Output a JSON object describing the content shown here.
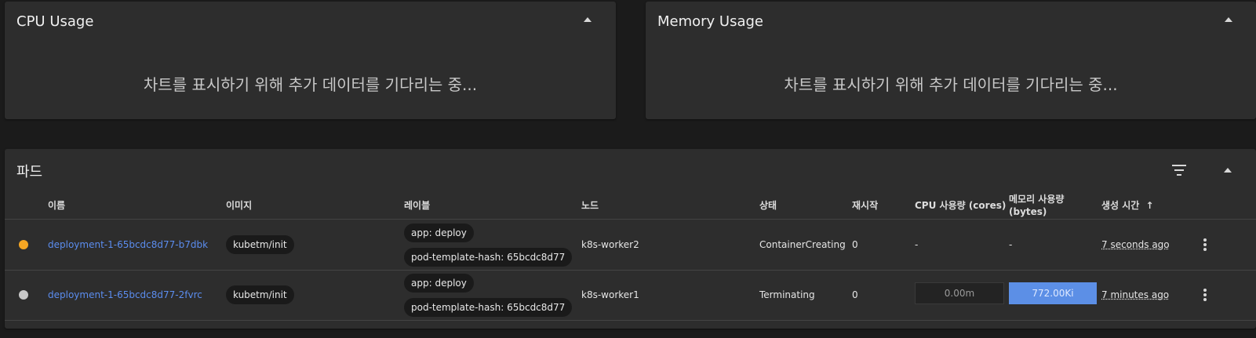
{
  "cpu_card": {
    "title": "CPU Usage",
    "waiting": "차트를 표시하기 위해 추가 데이터를 기다리는 중..."
  },
  "mem_card": {
    "title": "Memory Usage",
    "waiting": "차트를 표시하기 위해 추가 데이터를 기다리는 중..."
  },
  "pods": {
    "title": "파드",
    "columns": {
      "name": "이름",
      "image": "이미지",
      "labels": "레이블",
      "node": "노드",
      "status": "상태",
      "restarts": "재시작",
      "cpu": "CPU 사용량 (cores)",
      "mem_line1": "메모리 사용량",
      "mem_line2": "(bytes)",
      "created": "생성 시간",
      "sort_arrow": "↑"
    },
    "rows": [
      {
        "status_color": "#f5a623",
        "name": "deployment-1-65bcdc8d77-b7dbk",
        "image": "kubetm/init",
        "label1": "app: deploy",
        "label2": "pod-template-hash: 65bcdc8d77",
        "node": "k8s-worker2",
        "status": "ContainerCreating",
        "restarts": "0",
        "cpu": "-",
        "mem": "-",
        "created": "7 seconds ago"
      },
      {
        "status_color": "#c8c8c8",
        "name": "deployment-1-65bcdc8d77-2fvrc",
        "image": "kubetm/init",
        "label1": "app: deploy",
        "label2": "pod-template-hash: 65bcdc8d77",
        "node": "k8s-worker1",
        "status": "Terminating",
        "restarts": "0",
        "cpu": "0.00m",
        "mem": "772.00Ki",
        "created": "7 minutes ago"
      }
    ]
  },
  "icons": {
    "collapse": "chevron-up-icon",
    "filter": "filter-icon",
    "more": "more-vert-icon"
  }
}
